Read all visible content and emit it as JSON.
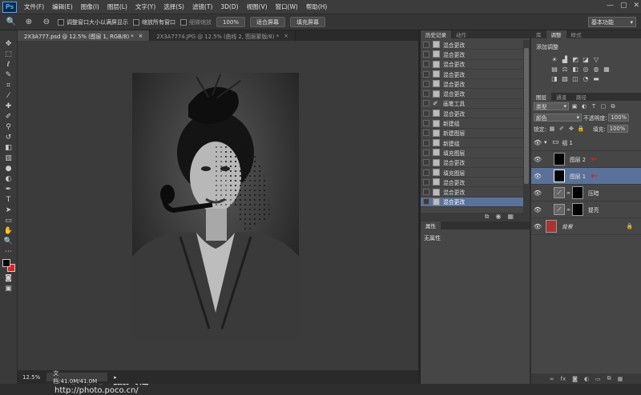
{
  "app": {
    "logo": "Ps"
  },
  "menu": [
    "文件(F)",
    "编辑(E)",
    "图像(I)",
    "图层(L)",
    "文字(Y)",
    "选择(S)",
    "滤镜(T)",
    "3D(D)",
    "视图(V)",
    "窗口(W)",
    "帮助(H)"
  ],
  "options_bar": {
    "chk_resize": "调整窗口大小以满屏显示",
    "chk_zoom_all": "缩放所有窗口",
    "chk_scrubby": "细微缩放",
    "btn_100": "100%",
    "btn_fit": "适合屏幕",
    "btn_fill": "填充屏幕",
    "workspace": "基本功能"
  },
  "doc_tabs": [
    {
      "title": "2X3A777.psd @ 12.5% (图层 1, RGB/8) *",
      "active": true
    },
    {
      "title": "2X3A7774.JPG @ 12.5% (曲线 2, 图层蒙版/8) *",
      "active": false
    }
  ],
  "status": {
    "zoom": "12.5%",
    "doc": "文档:41.0M/41.0M"
  },
  "watermark": {
    "brand": "POCO",
    "sub": "摄影专题",
    "url": "http://photo.poco.cn/"
  },
  "history_panel": {
    "tabs": [
      "历史记录",
      "动作"
    ],
    "rows": [
      "混合更改",
      "混合更改",
      "混合更改",
      "混合更改",
      "混合更改",
      "混合更改",
      "画笔工具",
      "混合更改",
      "新建组",
      "新建图层",
      "新建组",
      "填充图层",
      "混合更改",
      "填充图层",
      "混合更改",
      "混合更改",
      "混合更改"
    ],
    "selected_index": 16
  },
  "properties_panel": {
    "tabs": [
      "属性"
    ],
    "body": "无属性"
  },
  "right_tabs_top": [
    "库",
    "调整",
    "样式"
  ],
  "adjust_panel": {
    "title": "添加调整"
  },
  "layers_panel": {
    "tabs": [
      "图层",
      "通道",
      "路径"
    ],
    "filter_kind": "类型",
    "blend_mode": "颜色",
    "opacity_label": "不透明度:",
    "opacity_value": "100%",
    "lock_label": "锁定:",
    "fill_label": "填充:",
    "fill_value": "100%",
    "layers": [
      {
        "name": "组 1",
        "kind": "group"
      },
      {
        "name": "图层 2",
        "kind": "pixel",
        "arrow": true
      },
      {
        "name": "图层 1",
        "kind": "pixel",
        "arrow": true,
        "selected": true
      },
      {
        "name": "压暗",
        "kind": "adjustment"
      },
      {
        "name": "提亮",
        "kind": "adjustment"
      },
      {
        "name": "背景",
        "kind": "background"
      }
    ]
  },
  "colors": {
    "accent": "#5a7199",
    "fg": "#000000",
    "bg": "#dd2222",
    "arrow": "#e02020"
  }
}
